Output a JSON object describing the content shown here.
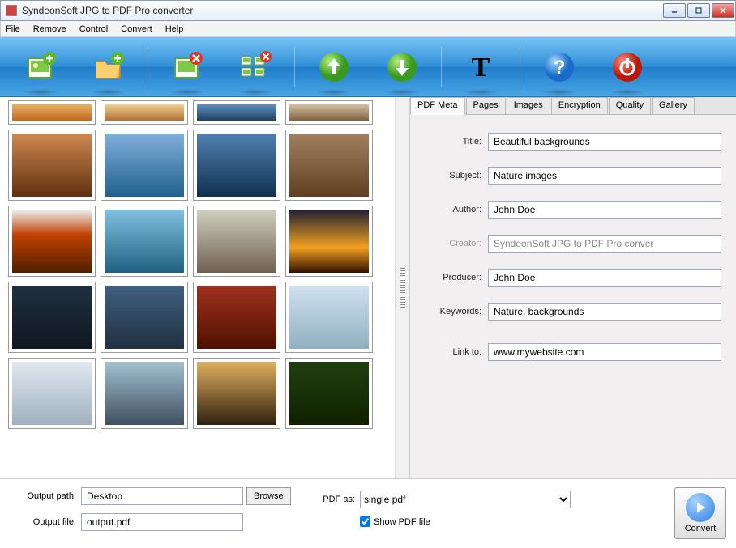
{
  "window": {
    "title": "SyndeonSoft JPG to PDF Pro converter"
  },
  "menu": [
    "File",
    "Remove",
    "Control",
    "Convert",
    "Help"
  ],
  "toolbar_icons": [
    "add-image",
    "add-folder",
    "remove-image",
    "remove-all",
    "move-up",
    "move-down",
    "text-tool",
    "help",
    "power"
  ],
  "tabs": [
    "PDF Meta",
    "Pages",
    "Images",
    "Encryption",
    "Quality",
    "Gallery"
  ],
  "active_tab": "PDF Meta",
  "meta": {
    "title_label": "Title:",
    "title": "Beautiful backgrounds",
    "subject_label": "Subject:",
    "subject": "Nature images",
    "author_label": "Author:",
    "author": "John Doe",
    "creator_label": "Creator:",
    "creator": "SyndeonSoft JPG to PDF Pro conver",
    "producer_label": "Producer:",
    "producer": "John Doe",
    "keywords_label": "Keywords:",
    "keywords": "Nature, backgrounds",
    "link_label": "Link to:",
    "link": "www.mywebsite.com"
  },
  "output": {
    "path_label": "Output path:",
    "path": "Desktop",
    "browse_label": "Browse",
    "file_label": "Output file:",
    "file": "output.pdf",
    "pdfas_label": "PDF as:",
    "pdfas_value": "single pdf",
    "show_label": "Show PDF file",
    "convert_label": "Convert"
  },
  "thumbs": [
    {
      "g": "linear-gradient(#e8b060,#c06820)"
    },
    {
      "g": "linear-gradient(#f0d090,#b07030)"
    },
    {
      "g": "linear-gradient(#6090c0,#204060)"
    },
    {
      "g": "linear-gradient(#d0c0a0,#806040)"
    },
    {
      "g": "linear-gradient(#d08850,#603010)"
    },
    {
      "g": "linear-gradient(#80b0d8,#206090)"
    },
    {
      "g": "linear-gradient(#5080b0,#103050)"
    },
    {
      "g": "linear-gradient(#a08060,#604020)"
    },
    {
      "g": "linear-gradient(#f0f0f0,#c04000 40%,#502000)"
    },
    {
      "g": "linear-gradient(#80c0e0,#206080)"
    },
    {
      "g": "linear-gradient(#d0d0c0,#706050)"
    },
    {
      "g": "linear-gradient(#202030,#f0a020 60%,#301000)"
    },
    {
      "g": "linear-gradient(#203040,#101820)"
    },
    {
      "g": "linear-gradient(#406080,#203040)"
    },
    {
      "g": "linear-gradient(#a03020,#501000)"
    },
    {
      "g": "linear-gradient(#d0e0f0,#90b0c0)"
    },
    {
      "g": "linear-gradient(#e0e8f0,#a0b0c0)"
    },
    {
      "g": "linear-gradient(#a0c0d0,#405060)"
    },
    {
      "g": "linear-gradient(#e0b060,#302010)"
    },
    {
      "g": "linear-gradient(#204010,#102000)"
    }
  ]
}
